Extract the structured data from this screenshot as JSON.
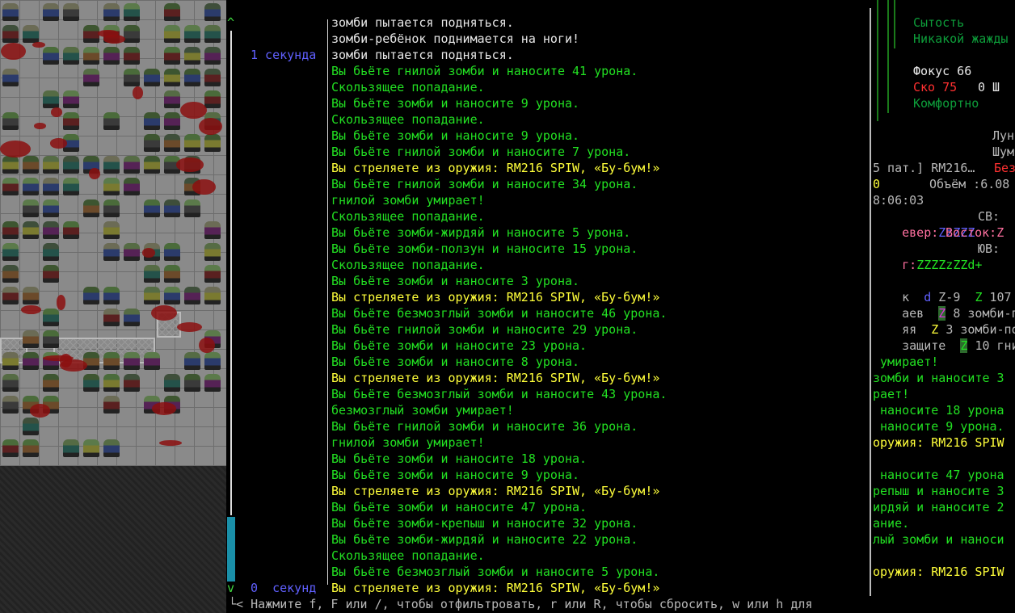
{
  "log": {
    "time_labels": [
      {
        "row": 2,
        "text": "1 секунда"
      },
      {
        "row": 35,
        "text": "0  секунд"
      }
    ],
    "messages": [
      {
        "text": "зомби пытается подняться.",
        "color": "white"
      },
      {
        "text": "зомби-ребёнок поднимается на ноги!",
        "color": "white"
      },
      {
        "text": "зомби пытается подняться.",
        "color": "white"
      },
      {
        "text": "Вы бьёте гнилой зомби и наносите 41 урона.",
        "color": "green"
      },
      {
        "text": "Скользящее попадание.",
        "color": "green"
      },
      {
        "text": "Вы бьёте зомби и наносите 9 урона.",
        "color": "green"
      },
      {
        "text": "Скользящее попадание.",
        "color": "green"
      },
      {
        "text": "Вы бьёте зомби и наносите 9 урона.",
        "color": "green"
      },
      {
        "text": "Вы бьёте гнилой зомби и наносите 7 урона.",
        "color": "green"
      },
      {
        "text": "Вы стреляете из оружия: RM216 SPIW, «Бу-бум!»",
        "color": "yellow"
      },
      {
        "text": "Вы бьёте гнилой зомби и наносите 34 урона.",
        "color": "green"
      },
      {
        "text": "гнилой зомби умирает!",
        "color": "green"
      },
      {
        "text": "Скользящее попадание.",
        "color": "green"
      },
      {
        "text": "Вы бьёте зомби-жирдяй и наносите 5 урона.",
        "color": "green"
      },
      {
        "text": "Вы бьёте зомби-ползун и наносите 15 урона.",
        "color": "green"
      },
      {
        "text": "Скользящее попадание.",
        "color": "green"
      },
      {
        "text": "Вы бьёте зомби и наносите 3 урона.",
        "color": "green"
      },
      {
        "text": "Вы стреляете из оружия: RM216 SPIW, «Бу-бум!»",
        "color": "yellow"
      },
      {
        "text": "Вы бьёте безмозглый зомби и наносите 46 урона.",
        "color": "green"
      },
      {
        "text": "Вы бьёте гнилой зомби и наносите 29 урона.",
        "color": "green"
      },
      {
        "text": "Вы бьёте зомби и наносите 23 урона.",
        "color": "green"
      },
      {
        "text": "Вы бьёте зомби и наносите 8 урона.",
        "color": "green"
      },
      {
        "text": "Вы стреляете из оружия: RM216 SPIW, «Бу-бум!»",
        "color": "yellow"
      },
      {
        "text": "Вы бьёте безмозглый зомби и наносите 43 урона.",
        "color": "green"
      },
      {
        "text": "безмозглый зомби умирает!",
        "color": "green"
      },
      {
        "text": "Вы бьёте гнилой зомби и наносите 36 урона.",
        "color": "green"
      },
      {
        "text": "гнилой зомби умирает!",
        "color": "green"
      },
      {
        "text": "Вы бьёте зомби и наносите 18 урона.",
        "color": "green"
      },
      {
        "text": "Вы бьёте зомби и наносите 9 урона.",
        "color": "green"
      },
      {
        "text": "Вы стреляете из оружия: RM216 SPIW, «Бу-бум!»",
        "color": "yellow"
      },
      {
        "text": "Вы бьёте зомби и наносите 47 урона.",
        "color": "green"
      },
      {
        "text": "Вы бьёте зомби-крепыш и наносите 32 урона.",
        "color": "green"
      },
      {
        "text": "Вы бьёте зомби-жирдяй и наносите 22 урона.",
        "color": "green"
      },
      {
        "text": "Скользящее попадание.",
        "color": "green"
      },
      {
        "text": "Вы бьёте безмозглый зомби и наносите 5 урона.",
        "color": "green"
      },
      {
        "text": "Вы стреляете из оружия: RM216 SPIW, «Бу-бум!»",
        "color": "yellow"
      }
    ],
    "scroll_up": "^",
    "scroll_down": "v",
    "footer_hint": "└< Нажмите f, F или /, чтобы отфильтровать, r или R, чтобы сбросить, w или h для"
  },
  "right_panel": {
    "satiety_label": "Сытость",
    "thirst_status": "Никакой жажды",
    "focus": "Фокус 66",
    "speed_label": "Ско 75",
    "speed_extra": "0 Ш",
    "comfort": "Комфортно",
    "moon": "Лун",
    "noise": "Шум",
    "ammo_line": "5 пат.] RM216…",
    "ammo_safe": "Без",
    "volume_zero": "0",
    "volume": "Объём :6.08",
    "clock": "8:06:03",
    "north_label": "евер:",
    "north_z": "ZzZZZ",
    "ne_label": "СВ:",
    "east_label": "Восток:Z",
    "south_label": "г:",
    "south_z": "ZZZZzZZd+",
    "se_label": "ЮВ:",
    "mon_rows": [
      {
        "prefix": "к",
        "glyph": "d",
        "glyph2": "Z-9",
        "glyph3": "Z",
        "text": "107 зо"
      },
      {
        "prefix": "аев",
        "glyph": "Z",
        "text": "8 зомби-пол"
      },
      {
        "prefix": "яя",
        "glyph": "Z",
        "text": "3 зомби-пожа"
      },
      {
        "prefix": "защите",
        "glyph": "Z",
        "text": "10 гниль"
      }
    ],
    "log_tail": [
      {
        "text": " умирает!",
        "color": "green"
      },
      {
        "text": "зомби и наносите 3",
        "color": "green"
      },
      {
        "text": "рает!",
        "color": "green"
      },
      {
        "text": " наносите 18 урона",
        "color": "green"
      },
      {
        "text": " наносите 9 урона.",
        "color": "green"
      },
      {
        "text": "оружия: RM216 SPIW",
        "color": "yellow"
      },
      {
        "text": "",
        "color": "green"
      },
      {
        "text": " наносите 47 урона",
        "color": "green"
      },
      {
        "text": "репыш и наносите 3",
        "color": "green"
      },
      {
        "text": "ирдяй и наносите 2",
        "color": "green"
      },
      {
        "text": "ание.",
        "color": "green"
      },
      {
        "text": "лый зомби и наноси",
        "color": "green"
      },
      {
        "text": "",
        "color": "green"
      },
      {
        "text": "оружия: RM216 SPIW",
        "color": "yellow"
      }
    ]
  },
  "colors": {
    "white": "#e8e8e8",
    "green": "#22e022",
    "yellow": "#ffff3a",
    "time_blue": "#6060ff",
    "status_dark_green": "#0d9d3a",
    "red": "#ff3030"
  }
}
